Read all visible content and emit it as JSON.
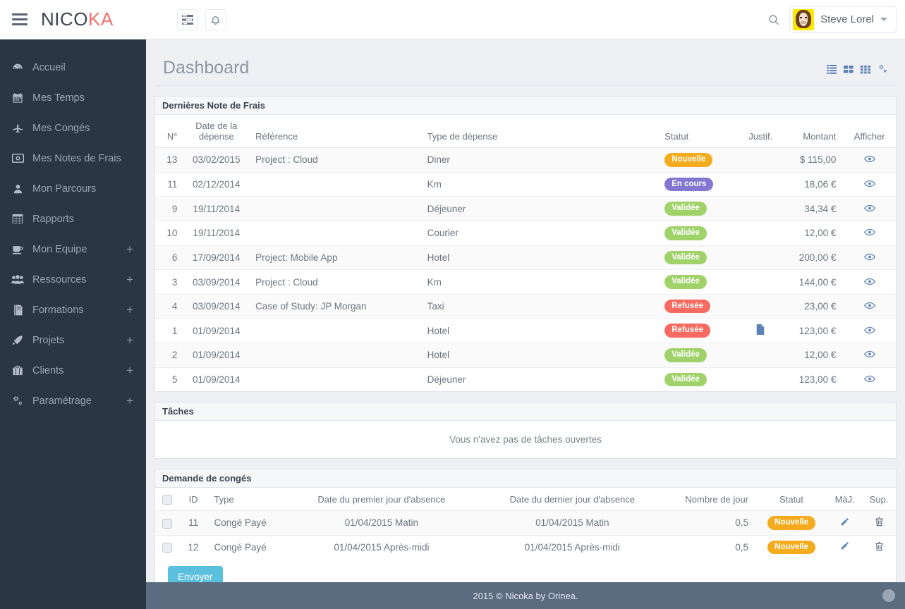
{
  "brand": {
    "part1": "NICO",
    "part2": "KA"
  },
  "topbar": {
    "tasks_icon": "tasks-icon",
    "bell_icon": "bell-icon",
    "search_icon": "search-icon",
    "user_name": "Steve Lorel"
  },
  "sidebar": {
    "items": [
      {
        "label": "Accueil",
        "icon": "dashboard-icon",
        "expand": ""
      },
      {
        "label": "Mes Temps",
        "icon": "calendar-icon",
        "expand": ""
      },
      {
        "label": "Mes Congés",
        "icon": "plane-icon",
        "expand": ""
      },
      {
        "label": "Mes Notes de Frais",
        "icon": "money-icon",
        "expand": ""
      },
      {
        "label": "Mon Parcours",
        "icon": "user-icon",
        "expand": ""
      },
      {
        "label": "Rapports",
        "icon": "table-icon",
        "expand": ""
      },
      {
        "label": "Mon Equipe",
        "icon": "coffee-icon",
        "expand": "+"
      },
      {
        "label": "Ressources",
        "icon": "group-icon",
        "expand": "+"
      },
      {
        "label": "Formations",
        "icon": "book-icon",
        "expand": "+"
      },
      {
        "label": "Projets",
        "icon": "rocket-icon",
        "expand": "+"
      },
      {
        "label": "Clients",
        "icon": "briefcase-icon",
        "expand": "+"
      },
      {
        "label": "Paramétrage",
        "icon": "gears-icon",
        "expand": "+"
      }
    ]
  },
  "page": {
    "title": "Dashboard",
    "view_icons": [
      "list-view-icon",
      "grid-2-view-icon",
      "grid-3-view-icon",
      "settings-gears-icon"
    ]
  },
  "expenses": {
    "panel_title": "Dernières Note de Frais",
    "headers": {
      "num": "N°",
      "date_l1": "Date de la",
      "date_l2": "dépense",
      "reference": "Référence",
      "type": "Type de dépense",
      "status": "Statut",
      "justif": "Justif.",
      "amount": "Montant",
      "show": "Afficher"
    },
    "rows": [
      {
        "num": "13",
        "date": "03/02/2015",
        "reference": "Project : Cloud",
        "type": "Diner",
        "status": "Nouvelle",
        "status_class": "b-nouvelle",
        "justif": false,
        "amount": "$ 115,00"
      },
      {
        "num": "11",
        "date": "02/12/2014",
        "reference": "",
        "type": "Km",
        "status": "En cours",
        "status_class": "b-encours",
        "justif": false,
        "amount": "18,06 €"
      },
      {
        "num": "9",
        "date": "19/11/2014",
        "reference": "",
        "type": "Déjeuner",
        "status": "Validée",
        "status_class": "b-validee",
        "justif": false,
        "amount": "34,34 €"
      },
      {
        "num": "10",
        "date": "19/11/2014",
        "reference": "",
        "type": "Courier",
        "status": "Validée",
        "status_class": "b-validee",
        "justif": false,
        "amount": "12,00 €"
      },
      {
        "num": "6",
        "date": "17/09/2014",
        "reference": "Project: Mobile App",
        "type": "Hotel",
        "status": "Validée",
        "status_class": "b-validee",
        "justif": false,
        "amount": "200,00 €"
      },
      {
        "num": "3",
        "date": "03/09/2014",
        "reference": "Project : Cloud",
        "type": "Km",
        "status": "Validée",
        "status_class": "b-validee",
        "justif": false,
        "amount": "144,00 €"
      },
      {
        "num": "4",
        "date": "03/09/2014",
        "reference": "Case of Study: JP Morgan",
        "type": "Taxi",
        "status": "Refusée",
        "status_class": "b-refusee",
        "justif": false,
        "amount": "23,00 €"
      },
      {
        "num": "1",
        "date": "01/09/2014",
        "reference": "",
        "type": "Hotel",
        "status": "Refusée",
        "status_class": "b-refusee",
        "justif": true,
        "amount": "123,00 €"
      },
      {
        "num": "2",
        "date": "01/09/2014",
        "reference": "",
        "type": "Hotel",
        "status": "Validée",
        "status_class": "b-validee",
        "justif": false,
        "amount": "12,00 €"
      },
      {
        "num": "5",
        "date": "01/09/2014",
        "reference": "",
        "type": "Déjeuner",
        "status": "Validée",
        "status_class": "b-validee",
        "justif": false,
        "amount": "123,00 €"
      }
    ]
  },
  "tasks": {
    "panel_title": "Tâches",
    "empty_message": "Vous n'avez pas de tâches ouvertes"
  },
  "leave": {
    "panel_title": "Demande de congés",
    "headers": {
      "id": "ID",
      "type": "Type",
      "first_day": "Date du premier jour d'absence",
      "last_day": "Date du dernier jour d'absence",
      "days": "Nombre de jour",
      "status": "Statut",
      "update": "MàJ.",
      "delete": "Sup."
    },
    "rows": [
      {
        "id": "11",
        "type": "Congé Payé",
        "first_day": "01/04/2015 Matin",
        "last_day": "01/04/2015 Matin",
        "days": "0,5",
        "status": "Nouvelle",
        "status_class": "b-nouvelle"
      },
      {
        "id": "12",
        "type": "Congé Payé",
        "first_day": "01/04/2015 Après-midi",
        "last_day": "01/04/2015 Après-midi",
        "days": "0,5",
        "status": "Nouvelle",
        "status_class": "b-nouvelle"
      }
    ],
    "submit_label": "Envoyer"
  },
  "footer": {
    "text": "2015 © Nicoka by Orinea."
  },
  "colors": {
    "sidebar_bg": "#2b3643",
    "accent_red": "#f1706b",
    "badge_new": "#f5ab1e",
    "badge_progress": "#8377d1",
    "badge_valid": "#9fd36a",
    "badge_refused": "#f76a62",
    "button_blue": "#5bc0de",
    "footer_bg": "#5b6b80"
  }
}
